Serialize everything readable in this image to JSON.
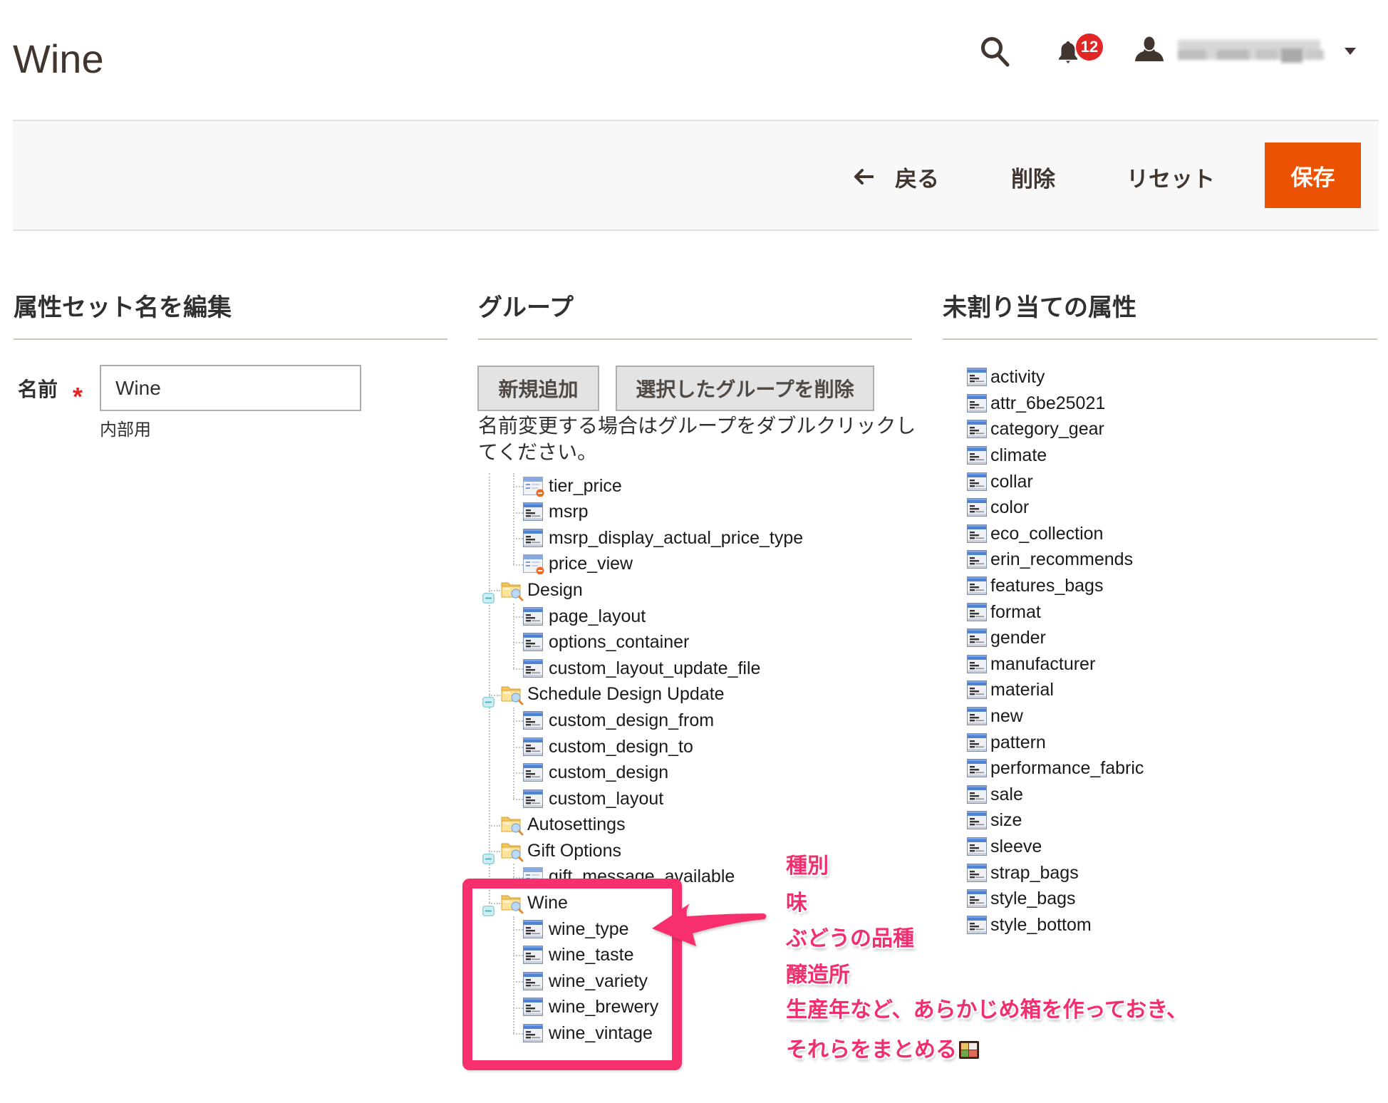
{
  "header": {
    "page_title": "Wine",
    "notifications_count": "12",
    "icons": {
      "search": "search-icon",
      "notifications": "bell-icon",
      "account": "user-icon",
      "account_menu": "caret-down-icon"
    }
  },
  "page_actions": {
    "back_label": "戻る",
    "delete_label": "削除",
    "reset_label": "リセット",
    "save_label": "保存"
  },
  "edit_set_name": {
    "heading": "属性セット名を編集",
    "name_label": "名前",
    "required_mark": "*",
    "name_value": "Wine",
    "name_note": "内部用"
  },
  "groups_panel": {
    "heading": "グループ",
    "add_new_label": "新規追加",
    "delete_selected_label": "選択したグループを削除",
    "help_text": "名前変更する場合はグループをダブルクリックしてください。",
    "tree": [
      {
        "label": "tier_price",
        "level": 1,
        "icon": "system-attribute-icon"
      },
      {
        "label": "msrp",
        "level": 1,
        "icon": "attribute-icon"
      },
      {
        "label": "msrp_display_actual_price_type",
        "level": 1,
        "icon": "attribute-icon"
      },
      {
        "label": "price_view",
        "level": 1,
        "icon": "system-attribute-icon"
      },
      {
        "label": "Design",
        "level": 0,
        "icon": "folder-icon",
        "expanded": true
      },
      {
        "label": "page_layout",
        "level": 1,
        "icon": "attribute-icon"
      },
      {
        "label": "options_container",
        "level": 1,
        "icon": "attribute-icon"
      },
      {
        "label": "custom_layout_update_file",
        "level": 1,
        "icon": "attribute-icon"
      },
      {
        "label": "Schedule Design Update",
        "level": 0,
        "icon": "folder-icon",
        "expanded": true
      },
      {
        "label": "custom_design_from",
        "level": 1,
        "icon": "attribute-icon"
      },
      {
        "label": "custom_design_to",
        "level": 1,
        "icon": "attribute-icon"
      },
      {
        "label": "custom_design",
        "level": 1,
        "icon": "attribute-icon"
      },
      {
        "label": "custom_layout",
        "level": 1,
        "icon": "attribute-icon"
      },
      {
        "label": "Autosettings",
        "level": 0,
        "icon": "folder-icon",
        "expanded": false
      },
      {
        "label": "Gift Options",
        "level": 0,
        "icon": "folder-icon",
        "expanded": true
      },
      {
        "label": "gift_message_available",
        "level": 1,
        "icon": "system-attribute-icon"
      },
      {
        "label": "Wine",
        "level": 0,
        "icon": "folder-icon",
        "expanded": true
      },
      {
        "label": "wine_type",
        "level": 1,
        "icon": "attribute-icon"
      },
      {
        "label": "wine_taste",
        "level": 1,
        "icon": "attribute-icon"
      },
      {
        "label": "wine_variety",
        "level": 1,
        "icon": "attribute-icon"
      },
      {
        "label": "wine_brewery",
        "level": 1,
        "icon": "attribute-icon"
      },
      {
        "label": "wine_vintage",
        "level": 1,
        "icon": "attribute-icon"
      }
    ]
  },
  "unassigned": {
    "heading": "未割り当ての属性",
    "attributes": [
      "activity",
      "attr_6be25021",
      "category_gear",
      "climate",
      "collar",
      "color",
      "eco_collection",
      "erin_recommends",
      "features_bags",
      "format",
      "gender",
      "manufacturer",
      "material",
      "new",
      "pattern",
      "performance_fabric",
      "sale",
      "size",
      "sleeve",
      "strap_bags",
      "style_bags",
      "style_bottom"
    ]
  },
  "annotation": {
    "highlighted_group": "Wine",
    "lines": [
      "種別",
      "味",
      "ぶどうの品種",
      "醸造所",
      "生産年など、あらかじめ箱を作っておき、",
      "それらをまとめる"
    ],
    "trailing_icon": "bento-box-icon"
  },
  "colors": {
    "primary_button": "#eb5202",
    "notification_badge": "#e22626",
    "required_mark": "#e22626",
    "annotation": "#f0306e",
    "highlight_box": "#f7306d"
  }
}
